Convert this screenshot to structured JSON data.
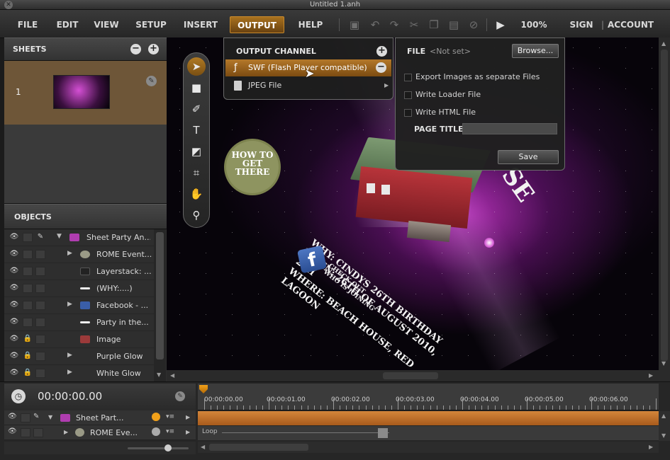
{
  "window": {
    "title": "Untitled 1.anh"
  },
  "menu": {
    "file": "FILE",
    "edit": "EDIT",
    "view": "VIEW",
    "setup": "SETUP",
    "insert": "INSERT",
    "output": "OUTPUT",
    "help": "HELP"
  },
  "toolbar": {
    "zoom": "100%",
    "sign_in": "SIGN IN",
    "divider": "|",
    "account": "ACCOUNT"
  },
  "sheets": {
    "title": "SHEETS",
    "items": [
      {
        "number": "1"
      }
    ]
  },
  "objects": {
    "title": "OBJECTS",
    "items": [
      {
        "label": "Sheet Party An..."
      },
      {
        "label": "ROME Event..."
      },
      {
        "label": "Layerstack: ..."
      },
      {
        "label": "(WHY:....)"
      },
      {
        "label": "Facebook - ..."
      },
      {
        "label": "Party in the..."
      },
      {
        "label": "Image"
      },
      {
        "label": "Purple Glow"
      },
      {
        "label": "White Glow"
      }
    ]
  },
  "output_menu": {
    "heading": "OUTPUT CHANNEL",
    "items": [
      {
        "label": "SWF (Flash Player compatible)"
      },
      {
        "label": "JPEG File"
      }
    ]
  },
  "export": {
    "file_label": "FILE",
    "file_value": "<Not set>",
    "browse": "Browse...",
    "options": [
      "Export Images as separate Files",
      "Write Loader File",
      "Write HTML File"
    ],
    "page_title_label": "PAGE TITLE",
    "page_title_value": "",
    "save": "Save"
  },
  "canvas": {
    "badge": "HOW TO GET THERE",
    "house_text": "SE",
    "party_lines": [
      "WHY: CINDYS 26TH BIRTHDAY",
      "WHEN: 26TH OF AUGUST 2010, 21H",
      "WHERE: BEACH HOUSE, RED LAGOON"
    ],
    "facebook_letter": "f",
    "fb_text": [
      "CHECK OUT",
      "WHO IS JOINING"
    ]
  },
  "timeline": {
    "time": "00:00:00.00",
    "marks": [
      "00:00:00.00",
      "00:00:01.00",
      "00:00:02.00",
      "00:00:03.00",
      "00:00:04.00",
      "00:00:05.00",
      "00:00:06.00"
    ],
    "rows": [
      {
        "label": "Sheet Part..."
      },
      {
        "label": "ROME Eve..."
      }
    ],
    "loop": "Loop"
  },
  "colors": {
    "accent": "#a8711e",
    "sheet_row": "#6e5638",
    "track": "#c7752a",
    "badge": "#8e9460"
  }
}
